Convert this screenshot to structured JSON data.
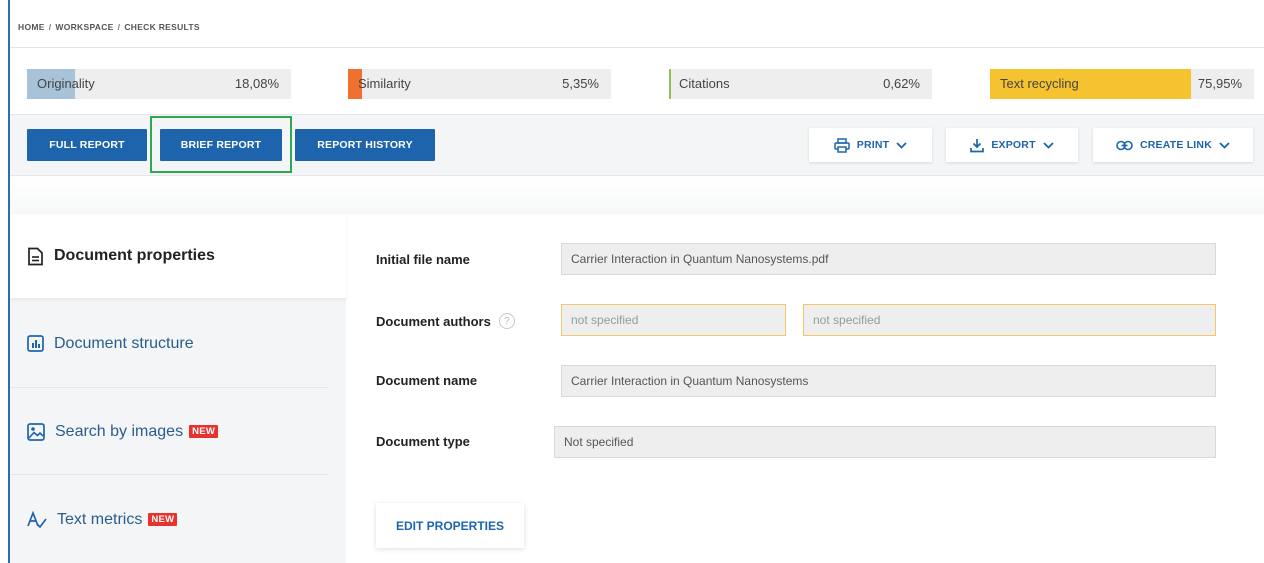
{
  "breadcrumb": [
    "HOME",
    "WORKSPACE",
    "CHECK RESULTS"
  ],
  "metrics": [
    {
      "label": "Originality",
      "value": "18,08%",
      "fraction": 0.1808,
      "color": "#a8c2d8"
    },
    {
      "label": "Similarity",
      "value": "5,35%",
      "fraction": 0.0535,
      "color": "#f07030"
    },
    {
      "label": "Citations",
      "value": "0,62%",
      "fraction": 0.0062,
      "color": "#8fc35a"
    },
    {
      "label": "Text recycling",
      "value": "75,95%",
      "fraction": 0.7595,
      "color": "#f5c230"
    }
  ],
  "toolbar": {
    "full_report": "FULL REPORT",
    "brief_report": "BRIEF REPORT",
    "report_history": "REPORT HISTORY",
    "print": "PRINT",
    "export": "EXPORT",
    "create_link": "CREATE LINK"
  },
  "sidebar": {
    "items": [
      {
        "label": "Document properties",
        "icon": "document-icon",
        "active": true
      },
      {
        "label": "Document structure",
        "icon": "structure-icon"
      },
      {
        "label": "Search by images",
        "icon": "image-search-icon",
        "badge": "NEW"
      },
      {
        "label": "Text metrics",
        "icon": "text-metrics-icon",
        "badge": "NEW"
      }
    ]
  },
  "form": {
    "initial_file_name_label": "Initial file name",
    "initial_file_name_value": "Carrier Interaction in Quantum Nanosystems.pdf",
    "document_authors_label": "Document authors",
    "help_glyph": "?",
    "author_first_placeholder": "not specified",
    "author_last_placeholder": "not specified",
    "document_name_label": "Document name",
    "document_name_value": "Carrier Interaction in Quantum Nanosystems",
    "document_type_label": "Document type",
    "document_type_value": "Not specified",
    "edit_properties": "EDIT PROPERTIES"
  },
  "colors": {
    "primary": "#1e64ad",
    "highlight": "#2fa84f",
    "badge": "#e8322e"
  }
}
